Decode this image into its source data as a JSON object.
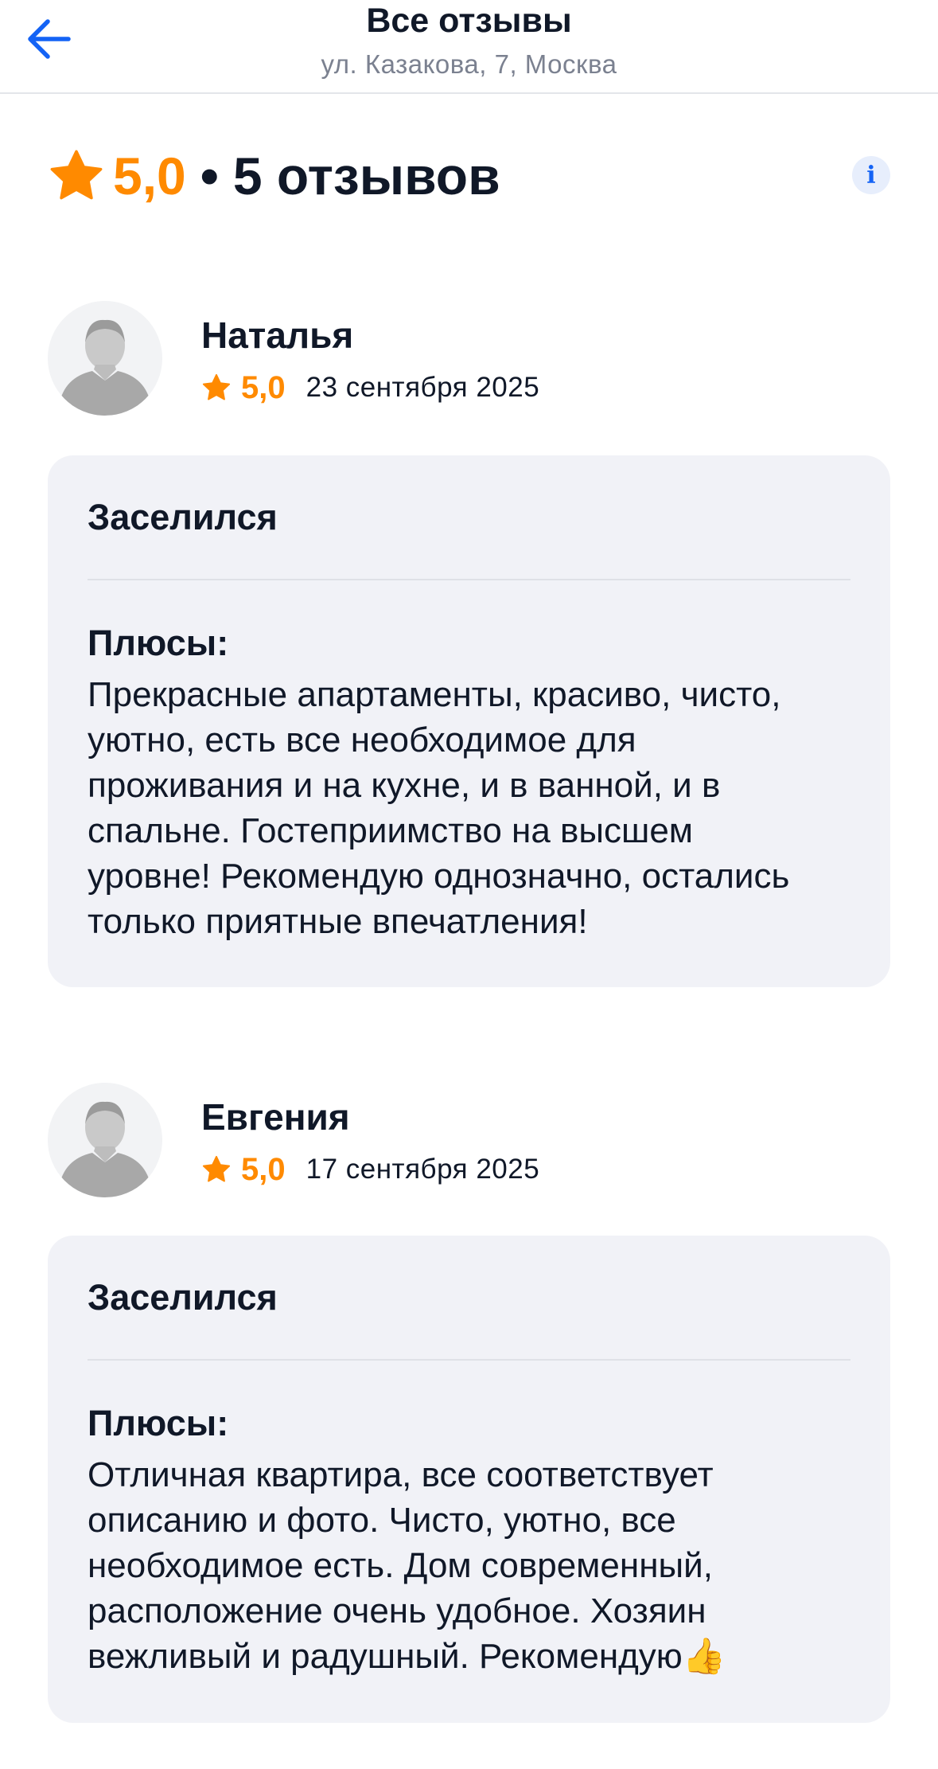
{
  "header": {
    "back_icon": "arrow-left-icon",
    "title": "Все отзывы",
    "subtitle": "ул. Казакова, 7, Москва"
  },
  "summary": {
    "star_icon": "star-icon",
    "rating": "5,0",
    "separator": "•",
    "count": "5 отзывов",
    "info_icon": "info-icon",
    "info_glyph": "i"
  },
  "reviews": [
    {
      "author": "Наталья",
      "rating": "5,0",
      "date": "23 сентября 2025",
      "stay_status": "Заселился",
      "pros_label": "Плюсы:",
      "pros_text": "Прекрасные апартаменты, красиво, чисто,\nуютно, есть все необходимое для\nпроживания и на кухне, и в ванной, и в\nспальне. Гостеприимство на высшем\nуровне! Рекомендую однозначно, остались\nтолько приятные впечатления!"
    },
    {
      "author": "Евгения",
      "rating": "5,0",
      "date": "17 сентября 2025",
      "stay_status": "Заселился",
      "pros_label": "Плюсы:",
      "pros_text": "Отличная квартира, все соответствует\nописанию и фото. Чисто, уютно, все\nнеобходимое есть. Дом современный,\nрасположение очень удобное. Хозяин\nвежливый и радушный. Рекомендую👍"
    }
  ],
  "colors": {
    "accent_blue": "#1463f5",
    "rating_orange": "#ff8a00",
    "card_bg": "#f1f2f7",
    "text_dark": "#101828",
    "text_muted": "#7b8190"
  }
}
